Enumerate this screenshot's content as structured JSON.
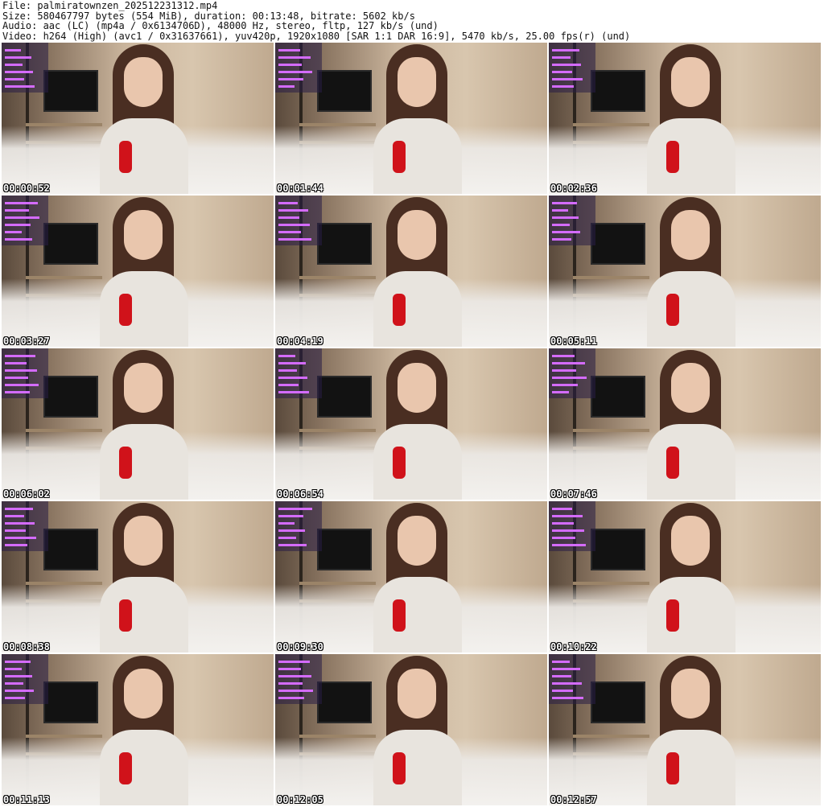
{
  "header": {
    "line1": "File: palmiratownzen_202512231312.mp4",
    "line2": "Size: 580467797 bytes (554 MiB), duration: 00:13:48, bitrate: 5602 kb/s",
    "line3": "Audio: aac (LC) (mp4a / 0x6134706D), 48000 Hz, stereo, fltp, 127 kb/s (und)",
    "line4": "Video: h264 (High) (avc1 / 0x31637661), yuv420p, 1920x1080 [SAR 1:1 DAR 16:9], 5470 kb/s, 25.00 fps(r) (und)"
  },
  "thumbnails": [
    {
      "timestamp": "00:00:52"
    },
    {
      "timestamp": "00:01:44"
    },
    {
      "timestamp": "00:02:36"
    },
    {
      "timestamp": "00:03:27"
    },
    {
      "timestamp": "00:04:19"
    },
    {
      "timestamp": "00:05:11"
    },
    {
      "timestamp": "00:06:02"
    },
    {
      "timestamp": "00:06:54"
    },
    {
      "timestamp": "00:07:46"
    },
    {
      "timestamp": "00:08:38"
    },
    {
      "timestamp": "00:09:30"
    },
    {
      "timestamp": "00:10:22"
    },
    {
      "timestamp": "00:11:13"
    },
    {
      "timestamp": "00:12:05"
    },
    {
      "timestamp": "00:12:57"
    }
  ]
}
